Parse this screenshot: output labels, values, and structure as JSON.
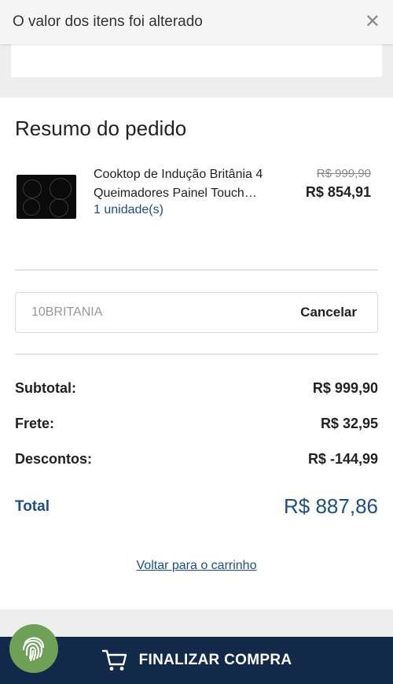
{
  "alert": {
    "message": "O valor dos itens foi alterado",
    "close_glyph": "✕"
  },
  "summary": {
    "title": "Resumo do pedido",
    "product": {
      "name": "Cooktop de Indução Britânia 4 Queimadores Painel Touch…",
      "quantity": "1 unidade(s)",
      "old_price": "R$ 999,90",
      "price": "R$ 854,91",
      "thumbnail_icon": "cooktop-image"
    },
    "coupon": {
      "code": "10BRITANIA",
      "cancel_label": "Cancelar"
    },
    "totals": {
      "subtotal_label": "Subtotal:",
      "subtotal_value": "R$ 999,90",
      "shipping_label": "Frete:",
      "shipping_value": "R$ 32,95",
      "discount_label": "Descontos:",
      "discount_value": "R$ -144,99",
      "total_label": "Total",
      "total_value": "R$ 887,86"
    },
    "back_link": "Voltar para o carrinho"
  },
  "footer": {
    "finalize_label": "FINALIZAR COMPRA",
    "cart_icon": "cart-icon",
    "fingerprint_icon": "fingerprint-icon"
  },
  "colors": {
    "brand_dark": "#12294a",
    "link_blue": "#1d4f86",
    "fingerprint_green": "#6fa057"
  }
}
